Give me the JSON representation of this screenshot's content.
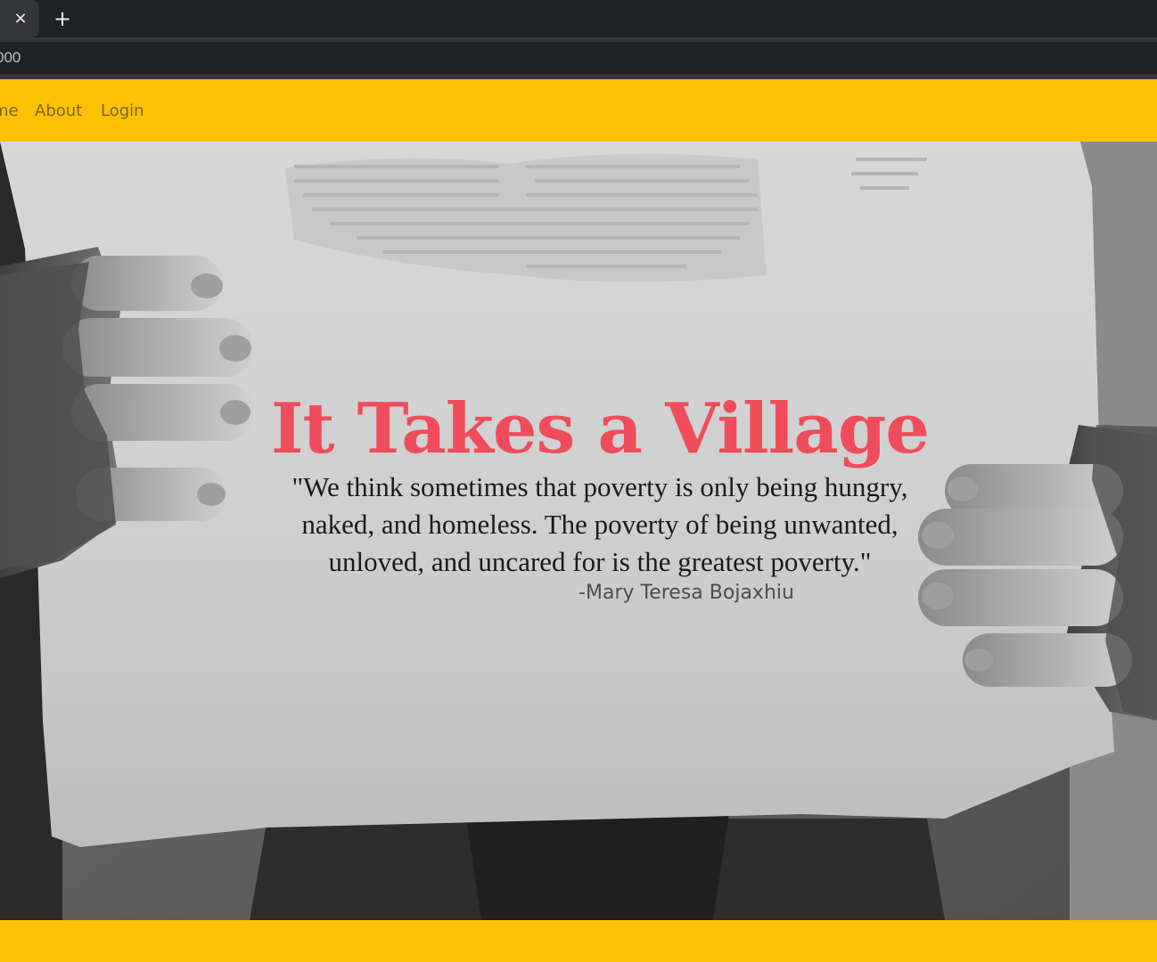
{
  "browser": {
    "close_tab_icon": "×",
    "new_tab_icon": "+",
    "address_text": "000"
  },
  "navbar": {
    "items": [
      {
        "label": "me"
      },
      {
        "label": "About"
      },
      {
        "label": "Login"
      }
    ],
    "background": "#ffc106"
  },
  "hero": {
    "title": "It Takes a Village",
    "quote": "\"We think sometimes that poverty is only being hungry, naked, and homeless. The poverty of being unwanted, unloved, and uncared for is the greatest poverty.\"",
    "author": "-Mary Teresa Bojaxhiu",
    "title_color": "#f04c5a",
    "image": "black-and-white photo of hands holding a cardboard sign"
  }
}
